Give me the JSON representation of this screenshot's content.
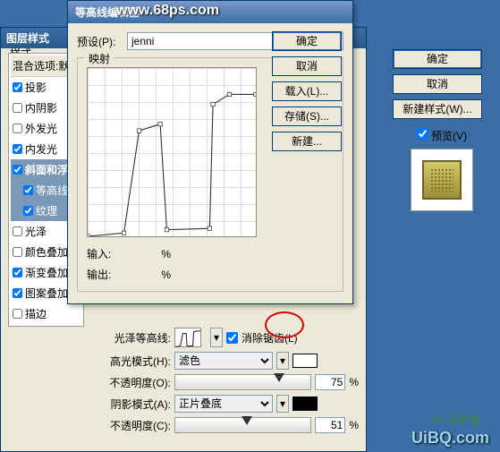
{
  "watermarks": {
    "w1": "www.68ps.com",
    "w2": "UiBQ.com",
    "w3": "Ps 爱好者"
  },
  "layerStyle": {
    "title": "图层样式",
    "stylesLabel": "样式",
    "blendOptionsLabel": "混合选项:默",
    "items": [
      {
        "label": "投影",
        "checked": true
      },
      {
        "label": "内阴影",
        "checked": false
      },
      {
        "label": "外发光",
        "checked": false
      },
      {
        "label": "内发光",
        "checked": true
      },
      {
        "label": "斜面和浮雕",
        "checked": true,
        "active": false,
        "bold": true
      },
      {
        "label": "等高线",
        "checked": true,
        "sub": true,
        "active": true
      },
      {
        "label": "纹理",
        "checked": true,
        "sub": true,
        "active": true
      },
      {
        "label": "光泽",
        "checked": false
      },
      {
        "label": "颜色叠加",
        "checked": false
      },
      {
        "label": "渐变叠加",
        "checked": true
      },
      {
        "label": "图案叠加",
        "checked": true
      },
      {
        "label": "描边",
        "checked": false
      }
    ]
  },
  "bevel": {
    "glossContourLabel": "光泽等高线:",
    "antiAliasLabel": "消除锯齿(L)",
    "antiAlias": true,
    "highlightModeLabel": "高光模式(H):",
    "highlightMode": "滤色",
    "highlightColor": "#ffffff",
    "opacityLabel": "不透明度(O):",
    "highlightOpacity": "75",
    "shadowModeLabel": "阴影模式(A):",
    "shadowMode": "正片叠底",
    "shadowColor": "#000000",
    "shadowOpacityLabel": "不透明度(C):",
    "shadowOpacity": "51",
    "percent": "%"
  },
  "rightButtons": {
    "ok": "确定",
    "cancel": "取消",
    "newStyle": "新建样式(W)...",
    "previewLabel": "预览(V)"
  },
  "contourEditor": {
    "title": "等高线编辑器",
    "presetLabel": "预设(P):",
    "presetValue": "jenni",
    "mapLabel": "映射",
    "inputLabel": "输入:",
    "outputLabel": "输出:",
    "percent": "%",
    "buttons": {
      "ok": "确定",
      "cancel": "取消",
      "load": "载入(L)...",
      "save": "存储(S)...",
      "new": "新建..."
    }
  },
  "chart_data": {
    "type": "line",
    "title": "映射",
    "xlabel": "输入",
    "ylabel": "输出",
    "xlim": [
      0,
      255
    ],
    "ylim": [
      0,
      255
    ],
    "x": [
      0,
      55,
      78,
      110,
      120,
      185,
      190,
      215,
      255
    ],
    "values": [
      0,
      5,
      160,
      170,
      10,
      12,
      200,
      215,
      215
    ]
  }
}
